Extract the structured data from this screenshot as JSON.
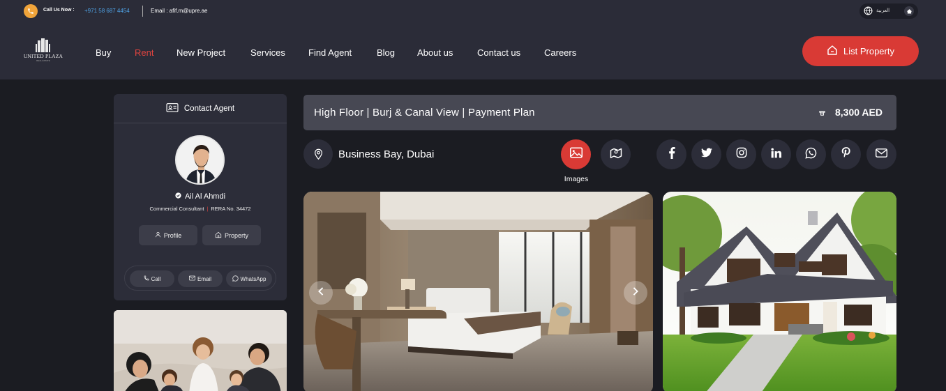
{
  "topbar": {
    "call_label": "Call Us Now :",
    "phone": "+971 58 687 4454",
    "email": "Email : afif.m@upre.ae",
    "language": "العربية"
  },
  "logo": {
    "name": "UNITED PLAZA",
    "sub": "REAL ESTATE"
  },
  "nav": {
    "items": [
      {
        "label": "Buy"
      },
      {
        "label": "Rent"
      },
      {
        "label": "New Project"
      },
      {
        "label": "Services"
      },
      {
        "label": "Find Agent"
      },
      {
        "label": "Blog"
      },
      {
        "label": "About us"
      },
      {
        "label": "Contact us"
      },
      {
        "label": "Careers"
      }
    ],
    "active": "Rent",
    "cta_label": "List Property"
  },
  "agent": {
    "header": "Contact Agent",
    "name": "Ail Al Ahmdi",
    "role": "Commercial Consultant",
    "rera": "RERA No. 34472",
    "profile_label": "Profile",
    "property_label": "Property",
    "call_label": "Call",
    "email_label": "Email",
    "whatsapp_label": "WhatsApp"
  },
  "listing": {
    "title": "High Floor | Burj & Canal View | Payment Plan",
    "price": "8,300 AED",
    "location": "Business Bay, Dubai",
    "images_label": "Images"
  },
  "colors": {
    "accent": "#d93a35",
    "background": "#1b1c22",
    "header": "#2b2c38",
    "card": "#2c2d39",
    "phone_link": "#4fa3e6"
  },
  "icons": [
    "phone-icon",
    "globe-icon",
    "home-icon",
    "id-card-icon",
    "verified-icon",
    "user-icon",
    "map-pin-icon",
    "image-icon",
    "map-icon",
    "facebook-icon",
    "twitter-icon",
    "instagram-icon",
    "linkedin-icon",
    "whatsapp-icon",
    "pinterest-icon",
    "mail-icon",
    "chevron-left-icon",
    "chevron-right-icon"
  ]
}
